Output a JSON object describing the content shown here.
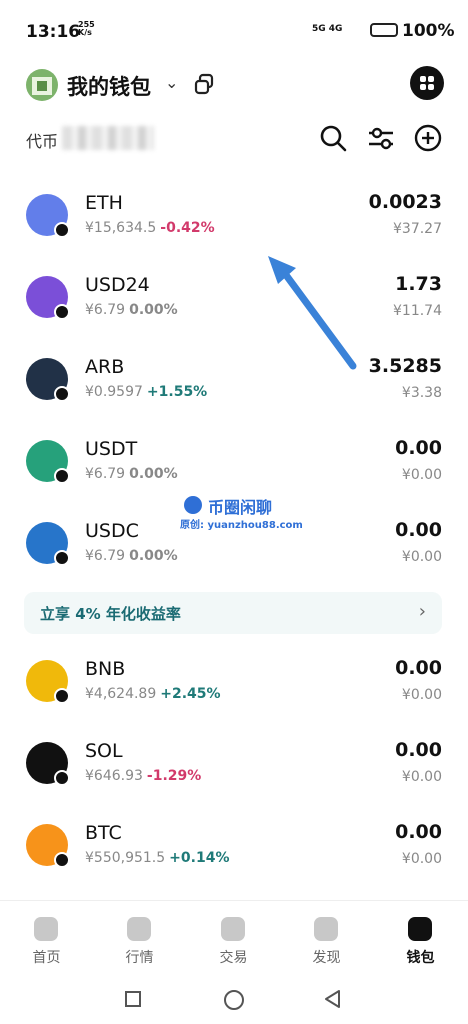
{
  "status_bar": {
    "time": "13:16",
    "speed_top": "255",
    "speed_bottom": "K/s",
    "network": "5G 4G",
    "battery": "100%"
  },
  "header": {
    "title": "我的钱包"
  },
  "token_bar": {
    "label": "代币"
  },
  "tokens": [
    {
      "symbol": "ETH",
      "price": "¥15,634.5",
      "change": "-0.42%",
      "amount": "0.0023",
      "value": "¥37.27",
      "color": "#627eea",
      "chg_color": "#d23a6b"
    },
    {
      "symbol": "USD24",
      "price": "¥6.79",
      "change": "0.00%",
      "amount": "1.73",
      "value": "¥11.74",
      "color": "#7b4fd8",
      "chg_color": "#888888"
    },
    {
      "symbol": "ARB",
      "price": "¥0.9597",
      "change": "+1.55%",
      "amount": "3.5285",
      "value": "¥3.38",
      "color": "#213147",
      "chg_color": "#1f7a78"
    },
    {
      "symbol": "USDT",
      "price": "¥6.79",
      "change": "0.00%",
      "amount": "0.00",
      "value": "¥0.00",
      "color": "#26a17b",
      "chg_color": "#888888"
    },
    {
      "symbol": "USDC",
      "price": "¥6.79",
      "change": "0.00%",
      "amount": "0.00",
      "value": "¥0.00",
      "color": "#2775ca",
      "chg_color": "#888888"
    },
    {
      "symbol": "BNB",
      "price": "¥4,624.89",
      "change": "+2.45%",
      "amount": "0.00",
      "value": "¥0.00",
      "color": "#f0b90b",
      "chg_color": "#1f7a78"
    },
    {
      "symbol": "SOL",
      "price": "¥646.93",
      "change": "-1.29%",
      "amount": "0.00",
      "value": "¥0.00",
      "color": "#111111",
      "chg_color": "#d23a6b"
    },
    {
      "symbol": "BTC",
      "price": "¥550,951.5",
      "change": "+0.14%",
      "amount": "0.00",
      "value": "¥0.00",
      "color": "#f7931a",
      "chg_color": "#1f7a78"
    }
  ],
  "promo": {
    "text": "立享 4% 年化收益率",
    "arrow": "›"
  },
  "watermark": {
    "title": "币圈闲聊",
    "url": "原创: yuanzhou88.com"
  },
  "tabs": [
    {
      "label": "首页"
    },
    {
      "label": "行情"
    },
    {
      "label": "交易"
    },
    {
      "label": "发现"
    },
    {
      "label": "钱包"
    }
  ]
}
